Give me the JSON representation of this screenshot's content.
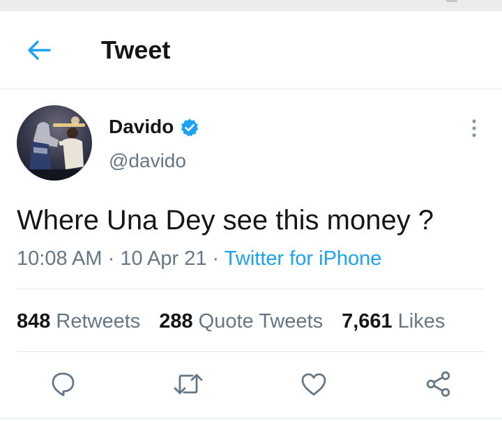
{
  "header": {
    "title": "Tweet",
    "back_icon": "arrow-left-icon"
  },
  "author": {
    "display_name": "Davido",
    "handle": "@davido",
    "verified_icon": "verified-badge-icon",
    "more_icon": "more-vertical-icon",
    "avatar": "avatar-photo"
  },
  "tweet": {
    "text": "Where Una Dey see this money ?",
    "time": "10:08 AM",
    "separator": "·",
    "date": "10 Apr 21",
    "source": "Twitter for iPhone"
  },
  "stats": {
    "retweets_count": "848",
    "retweets_label": "Retweets",
    "quotes_count": "288",
    "quotes_label": "Quote Tweets",
    "likes_count": "7,661",
    "likes_label": "Likes"
  },
  "actions": [
    {
      "icon": "reply-icon"
    },
    {
      "icon": "retweet-icon"
    },
    {
      "icon": "like-icon"
    },
    {
      "icon": "share-icon"
    }
  ],
  "colors": {
    "accent": "#1da1f2",
    "text_primary": "#14171a",
    "text_secondary": "#657786",
    "divider": "#e1e8ed"
  }
}
